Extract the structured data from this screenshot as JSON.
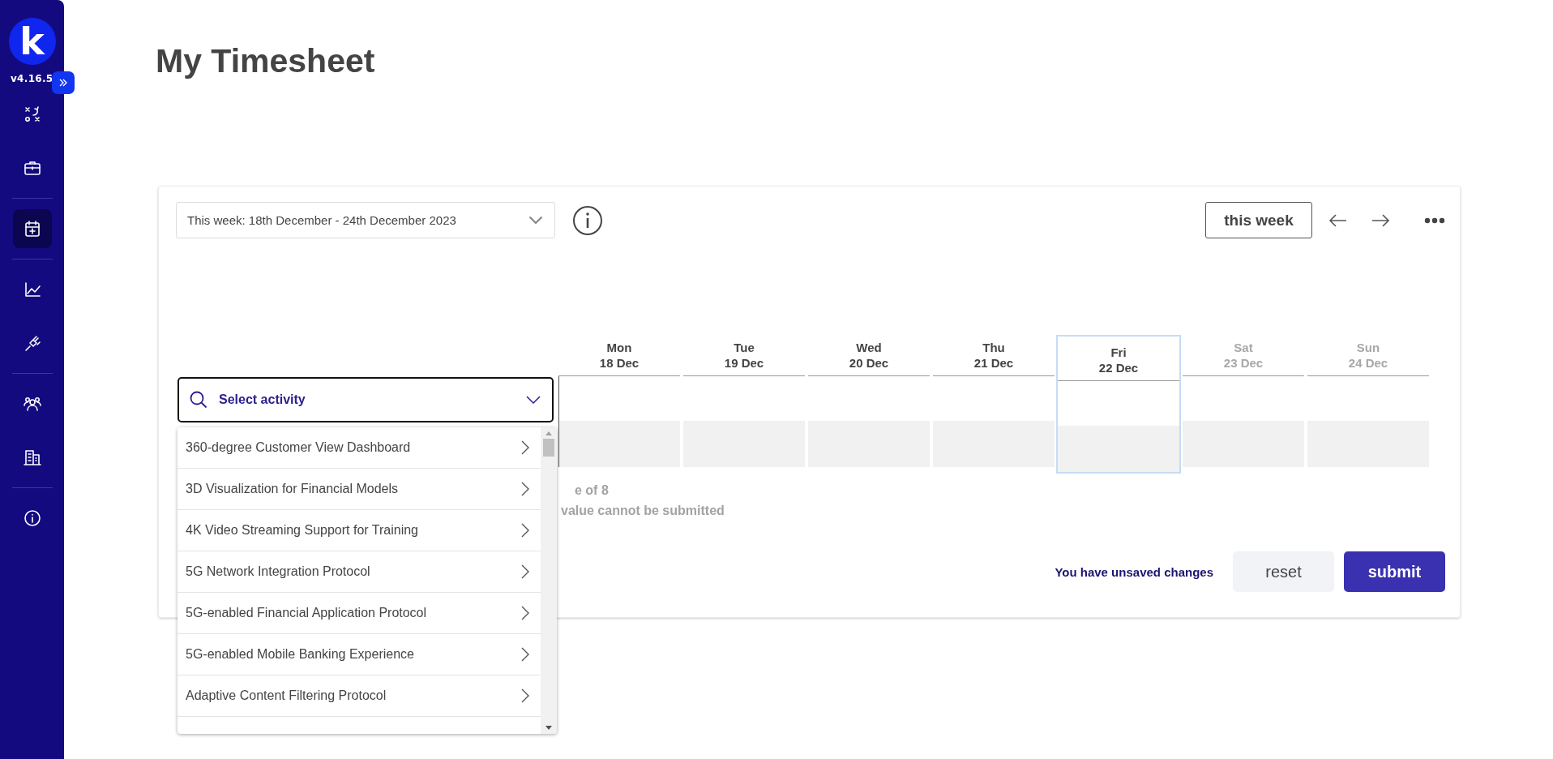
{
  "sidebar": {
    "logo": "k",
    "version": "v4.16.5",
    "groups": [
      [
        {
          "selected": false
        },
        {
          "selected": false
        }
      ],
      [
        {
          "selected": true
        }
      ],
      [
        {
          "selected": false
        },
        {
          "selected": false
        }
      ],
      [
        {
          "selected": false
        },
        {
          "selected": false
        }
      ],
      [
        {
          "selected": false
        }
      ]
    ]
  },
  "page": {
    "title": "My Timesheet"
  },
  "toolbar": {
    "week_select": "This week: 18th December - 24th December 2023",
    "this_week_button": "this week"
  },
  "timesheet": {
    "days": [
      {
        "name": "Mon",
        "date": "18 Dec",
        "weekend": false,
        "today": false
      },
      {
        "name": "Tue",
        "date": "19 Dec",
        "weekend": false,
        "today": false
      },
      {
        "name": "Wed",
        "date": "20 Dec",
        "weekend": false,
        "today": false
      },
      {
        "name": "Thu",
        "date": "21 Dec",
        "weekend": false,
        "today": false
      },
      {
        "name": "Fri",
        "date": "22 Dec",
        "weekend": false,
        "today": true
      },
      {
        "name": "Sat",
        "date": "23 Dec",
        "weekend": true,
        "today": false
      },
      {
        "name": "Sun",
        "date": "24 Dec",
        "weekend": true,
        "today": false
      }
    ],
    "activity_field": {
      "placeholder": "Select activity"
    },
    "activity_options": [
      "360-degree Customer View Dashboard",
      "3D Visualization for Financial Models",
      "4K Video Streaming Support for Training",
      "5G Network Integration Protocol",
      "5G-enabled Financial Application Protocol",
      "5G-enabled Mobile Banking Experience",
      "Adaptive Content Filtering Protocol"
    ],
    "notes": [
      "e of 8",
      "value cannot be submitted"
    ]
  },
  "footer": {
    "status": "You have unsaved changes",
    "buttons": [
      {
        "label": "reset",
        "kind": "secondary"
      },
      {
        "label": "submit",
        "kind": "primary"
      }
    ]
  }
}
